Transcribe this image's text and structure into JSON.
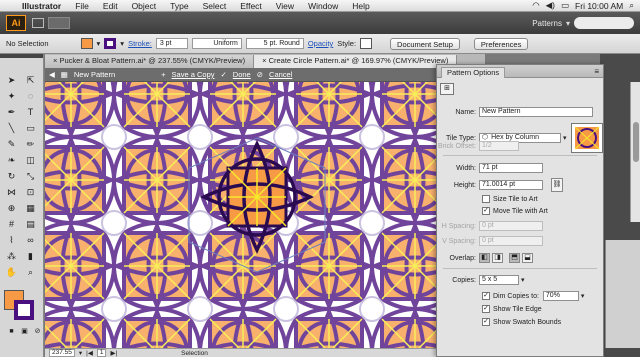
{
  "menubar": {
    "app_name": "Illustrator",
    "items": [
      "File",
      "Edit",
      "Object",
      "Type",
      "Select",
      "Effect",
      "View",
      "Window",
      "Help"
    ],
    "clock": "Fri 10:00 AM"
  },
  "appbar": {
    "logo": "Ai",
    "workspace": "Patterns"
  },
  "control": {
    "selection": "No Selection",
    "fill_color": "#f79a45",
    "stroke_color": "#4a1080",
    "stroke_label": "Stroke:",
    "stroke_value": "3 pt",
    "profile_value": "Uniform",
    "brush_value": "5 pt. Round",
    "opacity_label": "Opacity",
    "style_label": "Style:",
    "doc_setup": "Document Setup",
    "preferences": "Preferences"
  },
  "tabs": [
    {
      "label": "Pucker & Bloat Pattern.ai* @ 237.55% (CMYK/Preview)"
    },
    {
      "label": "Create Circle Pattern.ai* @ 169.97% (CMYK/Preview)"
    }
  ],
  "isolation": {
    "pattern_name": "New Pattern",
    "save_copy": "Save a Copy",
    "done": "Done",
    "cancel": "Cancel"
  },
  "status": {
    "zoom": "237.55",
    "artboard": "1",
    "mode": "Selection"
  },
  "pattern_options": {
    "title": "Pattern Options",
    "name_label": "Name:",
    "name_value": "New Pattern",
    "tile_type_label": "Tile Type:",
    "tile_type_value": "Hex by Column",
    "brick_offset_label": "Brick Offset:",
    "brick_offset_value": "1/2",
    "width_label": "Width:",
    "width_value": "71 pt",
    "height_label": "Height:",
    "height_value": "71.0014 pt",
    "size_tile_to_art": "Size Tile to Art",
    "size_tile_to_art_checked": false,
    "move_tile_with_art": "Move Tile with Art",
    "move_tile_with_art_checked": true,
    "h_spacing_label": "H Spacing:",
    "h_spacing_value": "0 pt",
    "v_spacing_label": "V Spacing:",
    "v_spacing_value": "0 pt",
    "overlap_label": "Overlap:",
    "copies_label": "Copies:",
    "copies_value": "5 x 5",
    "dim_copies": "Dim Copies to:",
    "dim_copies_checked": true,
    "dim_value": "70%",
    "show_tile_edge": "Show Tile Edge",
    "show_tile_edge_checked": true,
    "show_swatch_bounds": "Show Swatch Bounds",
    "show_swatch_bounds_checked": true
  },
  "colors": {
    "orange": "#f79a45",
    "purple": "#4a1080",
    "yellow": "#f7ea2a",
    "dim_lilac": "#b4a9d4"
  }
}
